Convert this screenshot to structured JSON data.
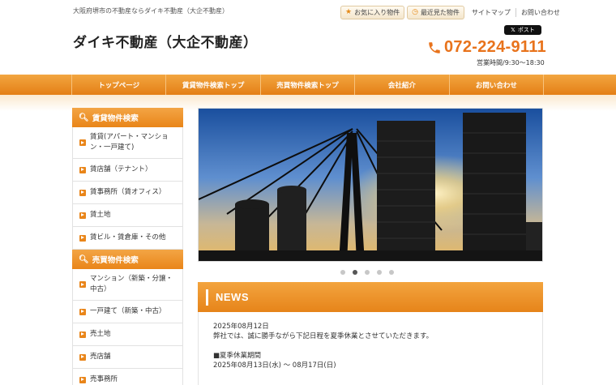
{
  "header": {
    "tagline": "大阪府堺市の不動産ならダイキ不動産（大企不動産）",
    "site_title": "ダイキ不動産（大企不動産）",
    "favorites_label": "お気に入り物件",
    "recent_label": "最近見た物件",
    "sitemap_label": "サイトマップ",
    "contact_label": "お問い合わせ",
    "x_post_label": "ポスト",
    "phone": "072-224-9111",
    "hours": "営業時間/9:30～18:30"
  },
  "nav": {
    "items": [
      {
        "label": "トップページ"
      },
      {
        "label": "賃貸物件検索トップ"
      },
      {
        "label": "売買物件検索トップ"
      },
      {
        "label": "会社紹介"
      },
      {
        "label": "お問い合わせ"
      }
    ]
  },
  "sidebar": {
    "rental_heading": "賃貸物件検索",
    "rental_items": [
      {
        "label": "賃貸(アパート・マンション・一戸建て)"
      },
      {
        "label": "賃店舗（テナント）"
      },
      {
        "label": "賃事務所（賃オフィス）"
      },
      {
        "label": "賃土地"
      },
      {
        "label": "賃ビル・賃倉庫・その他"
      }
    ],
    "sale_heading": "売買物件検索",
    "sale_items": [
      {
        "label": "マンション（新築・分譲・中古）"
      },
      {
        "label": "一戸建て（新築・中古）"
      },
      {
        "label": "売土地"
      },
      {
        "label": "売店舗"
      },
      {
        "label": "売事務所"
      }
    ]
  },
  "slider": {
    "slide_count": 5,
    "active_index": 1
  },
  "news": {
    "title": "NEWS",
    "date": "2025年08月12日",
    "text": "弊社では、誠に勝手ながら下記日程を夏季休業とさせていただきます。",
    "period_heading": "■夏季休業期間",
    "period": "2025年08月13日(水) ～ 08月17日(日)"
  },
  "colors": {
    "accent": "#e8861a",
    "phone": "#e8731c"
  }
}
